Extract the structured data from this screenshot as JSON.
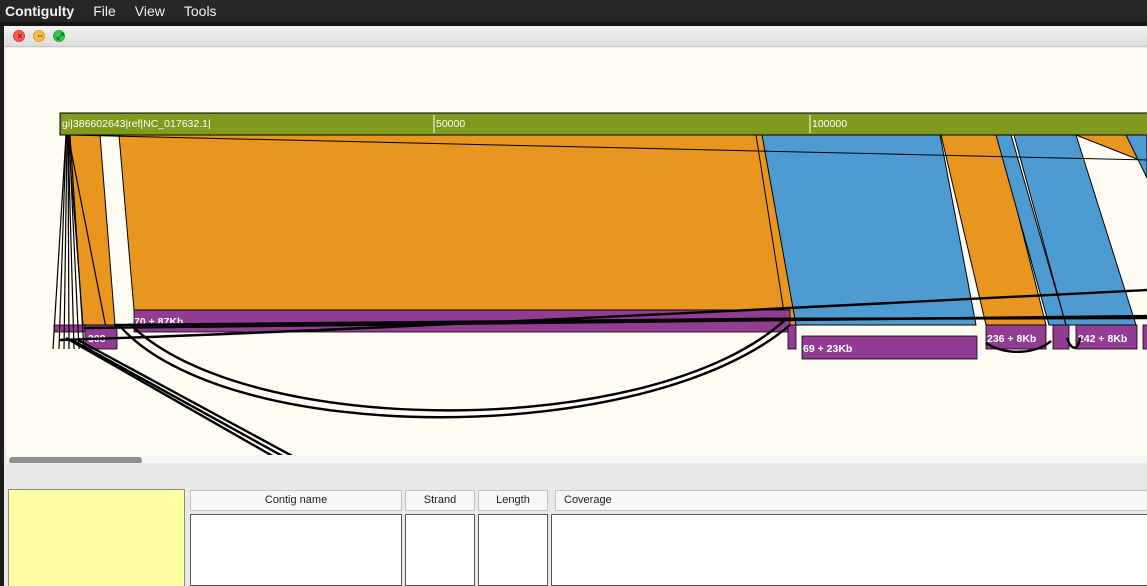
{
  "menubar": {
    "app_name": "Contigulty",
    "menus": [
      "File",
      "View",
      "Tools"
    ]
  },
  "window": {
    "close_glyph": "×",
    "minimize_glyph": "−",
    "zoom_glyph": "⤢"
  },
  "reference": {
    "label": "gi|386602643|ref|NC_017632.1|",
    "ticks": [
      "50000",
      "100000"
    ]
  },
  "contigs": {
    "labels": [
      "308",
      "70 + 87Kb",
      "69 + 23Kb",
      "236 + 8Kb",
      "242 + 8Kb"
    ]
  },
  "table": {
    "columns": [
      "Contig name",
      "Strand",
      "Length",
      "Coverage"
    ]
  },
  "colors": {
    "reference_bar": "#7f9a1c",
    "forward_match": "#e89620",
    "reverse_match": "#4d9bd0",
    "contig": "#923c93",
    "canvas_bg": "#fffcf3"
  }
}
